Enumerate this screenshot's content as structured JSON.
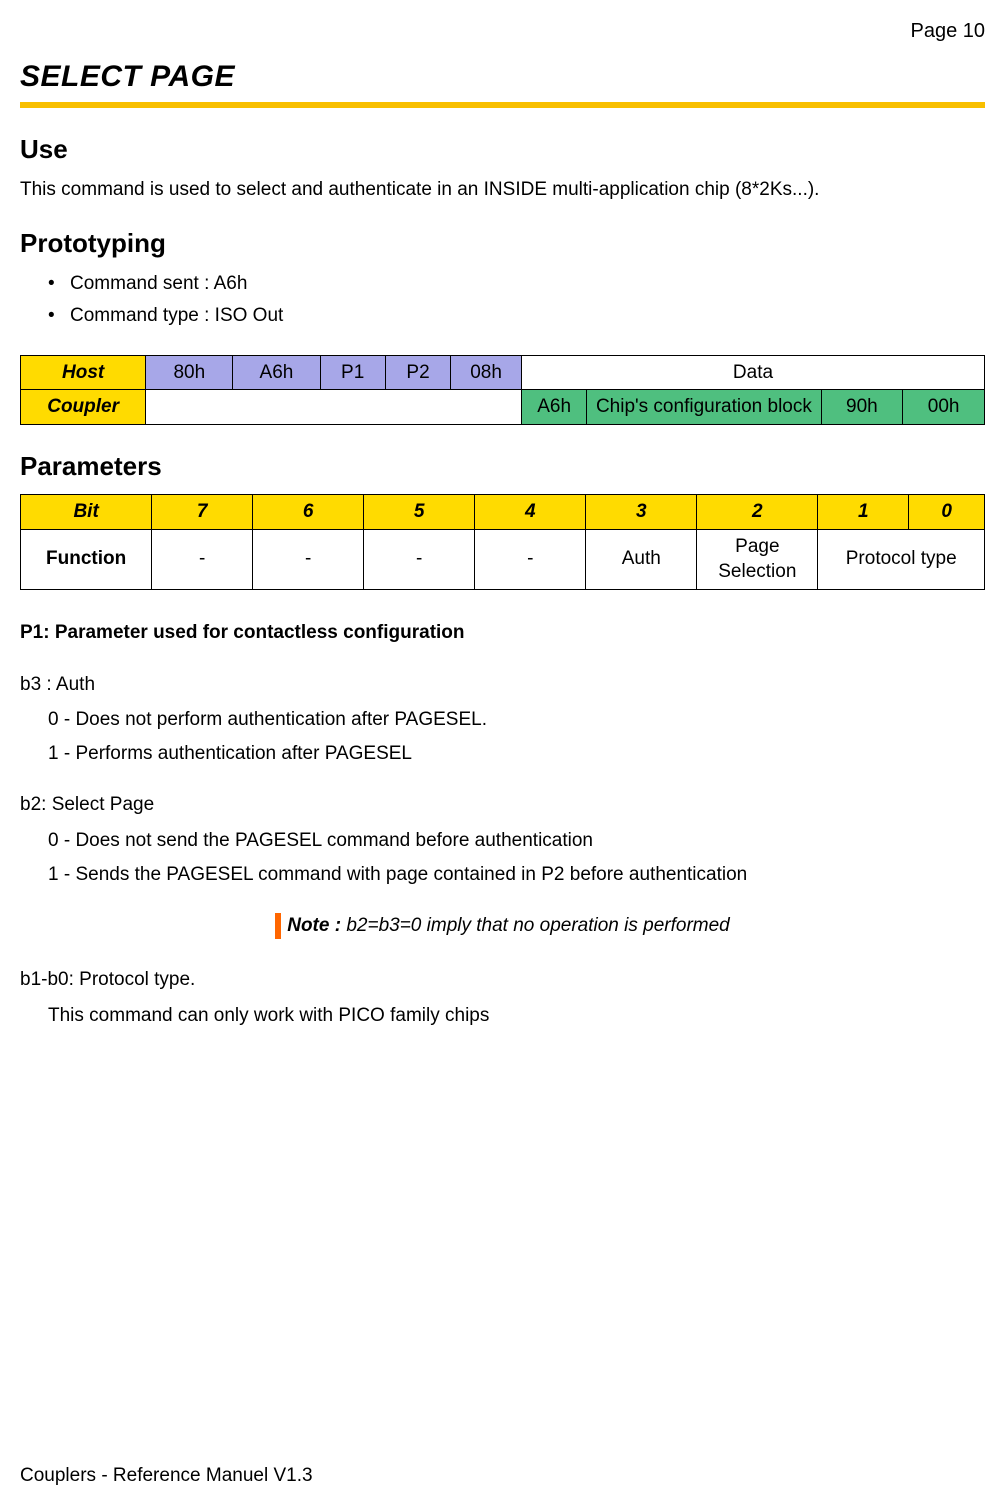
{
  "page_label": "Page 10",
  "title": "SELECT PAGE",
  "sections": {
    "use_heading": "Use",
    "use_text": "This command is used to select and authenticate in an INSIDE multi-application chip (8*2Ks...).",
    "proto_heading": "Prototyping",
    "proto_bullets": [
      "Command sent : A6h",
      "Command type : ISO Out"
    ],
    "params_heading": "Parameters",
    "p1_subhead": "P1: Parameter used for contactless configuration"
  },
  "hc_table": {
    "row1": {
      "label": "Host",
      "cells": [
        "80h",
        "A6h",
        "P1",
        "P2",
        "08h"
      ],
      "data_label": "Data"
    },
    "row2": {
      "label": "Coupler",
      "cells": [
        "A6h",
        "Chip's configuration block",
        "90h",
        "00h"
      ]
    }
  },
  "params_table": {
    "headers": [
      "Bit",
      "7",
      "6",
      "5",
      "4",
      "3",
      "2",
      "1",
      "0"
    ],
    "row_label": "Function",
    "cells": [
      "-",
      "-",
      "-",
      "-",
      "Auth",
      "Page Selection",
      "Protocol type"
    ]
  },
  "b3": {
    "lead": "b3 : Auth",
    "i0": "0 - Does not perform authentication after PAGESEL.",
    "i1": "1 - Performs authentication after PAGESEL"
  },
  "b2": {
    "lead": "b2: Select Page",
    "i0": "0 - Does not send the PAGESEL command before authentication",
    "i1": "1 - Sends the PAGESEL command with page contained in P2 before authentication"
  },
  "note": {
    "label": "Note :",
    "text": " b2=b3=0 imply that no operation is performed"
  },
  "b10": {
    "lead": "b1-b0: Protocol type.",
    "text": "This command can only work with PICO family chips"
  },
  "footer": "Couplers - Reference Manuel V1.3"
}
